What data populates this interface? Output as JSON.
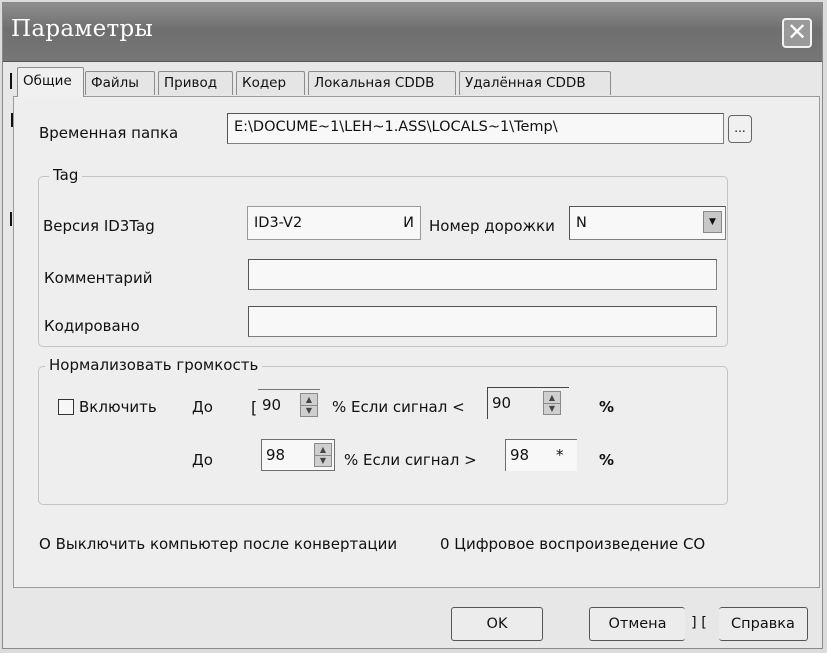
{
  "window": {
    "title": "Параметры",
    "close_symbol": "✕"
  },
  "tabs": [
    {
      "label": "Общие",
      "active": true
    },
    {
      "label": "Файлы"
    },
    {
      "label": "Привод"
    },
    {
      "label": "Кодер"
    },
    {
      "label": "Локальная CDDB"
    },
    {
      "label": "Удалённая CDDB"
    }
  ],
  "temp": {
    "label": "Временная папка",
    "value": "E:\\DOCUME~1\\LEH~1.ASS\\LOCALS~1\\Temp\\",
    "browse_label": "..."
  },
  "tag": {
    "group_title": "Tag",
    "version_label": "Версия ID3Tag",
    "version_value": "ID3-V2",
    "version_suffix": "И",
    "track_label": "Номер дорожки",
    "track_value": "N",
    "comment_label": "Комментарий",
    "comment_value": "",
    "encoded_label": "Кодировано",
    "encoded_value": ""
  },
  "normalize": {
    "group_title": "Нормализовать громкость",
    "enable_label": "Включить",
    "enabled": false,
    "row1": {
      "to_label": "До",
      "to_value": "90",
      "prefix": "[",
      "pct_label": "% Если сигнал <",
      "signal_value": "90",
      "pct_end": "%"
    },
    "row2": {
      "to_label": "До",
      "to_value": "98",
      "pct_label": "% Если сигнал >",
      "signal_value": "98",
      "signal_mark": "*",
      "pct_end": "%"
    }
  },
  "options": {
    "shutdown_label": "O Выключить компьютер после конвертации",
    "digital_label": "0 Цифровое воспроизведение CO"
  },
  "buttons": {
    "ok": "OK",
    "cancel": "Отмена",
    "help_prefix": "] [",
    "help": "Справка"
  },
  "colors": {
    "titlebar": "#7a7a7a",
    "dialog_bg": "#e7e7e7"
  }
}
